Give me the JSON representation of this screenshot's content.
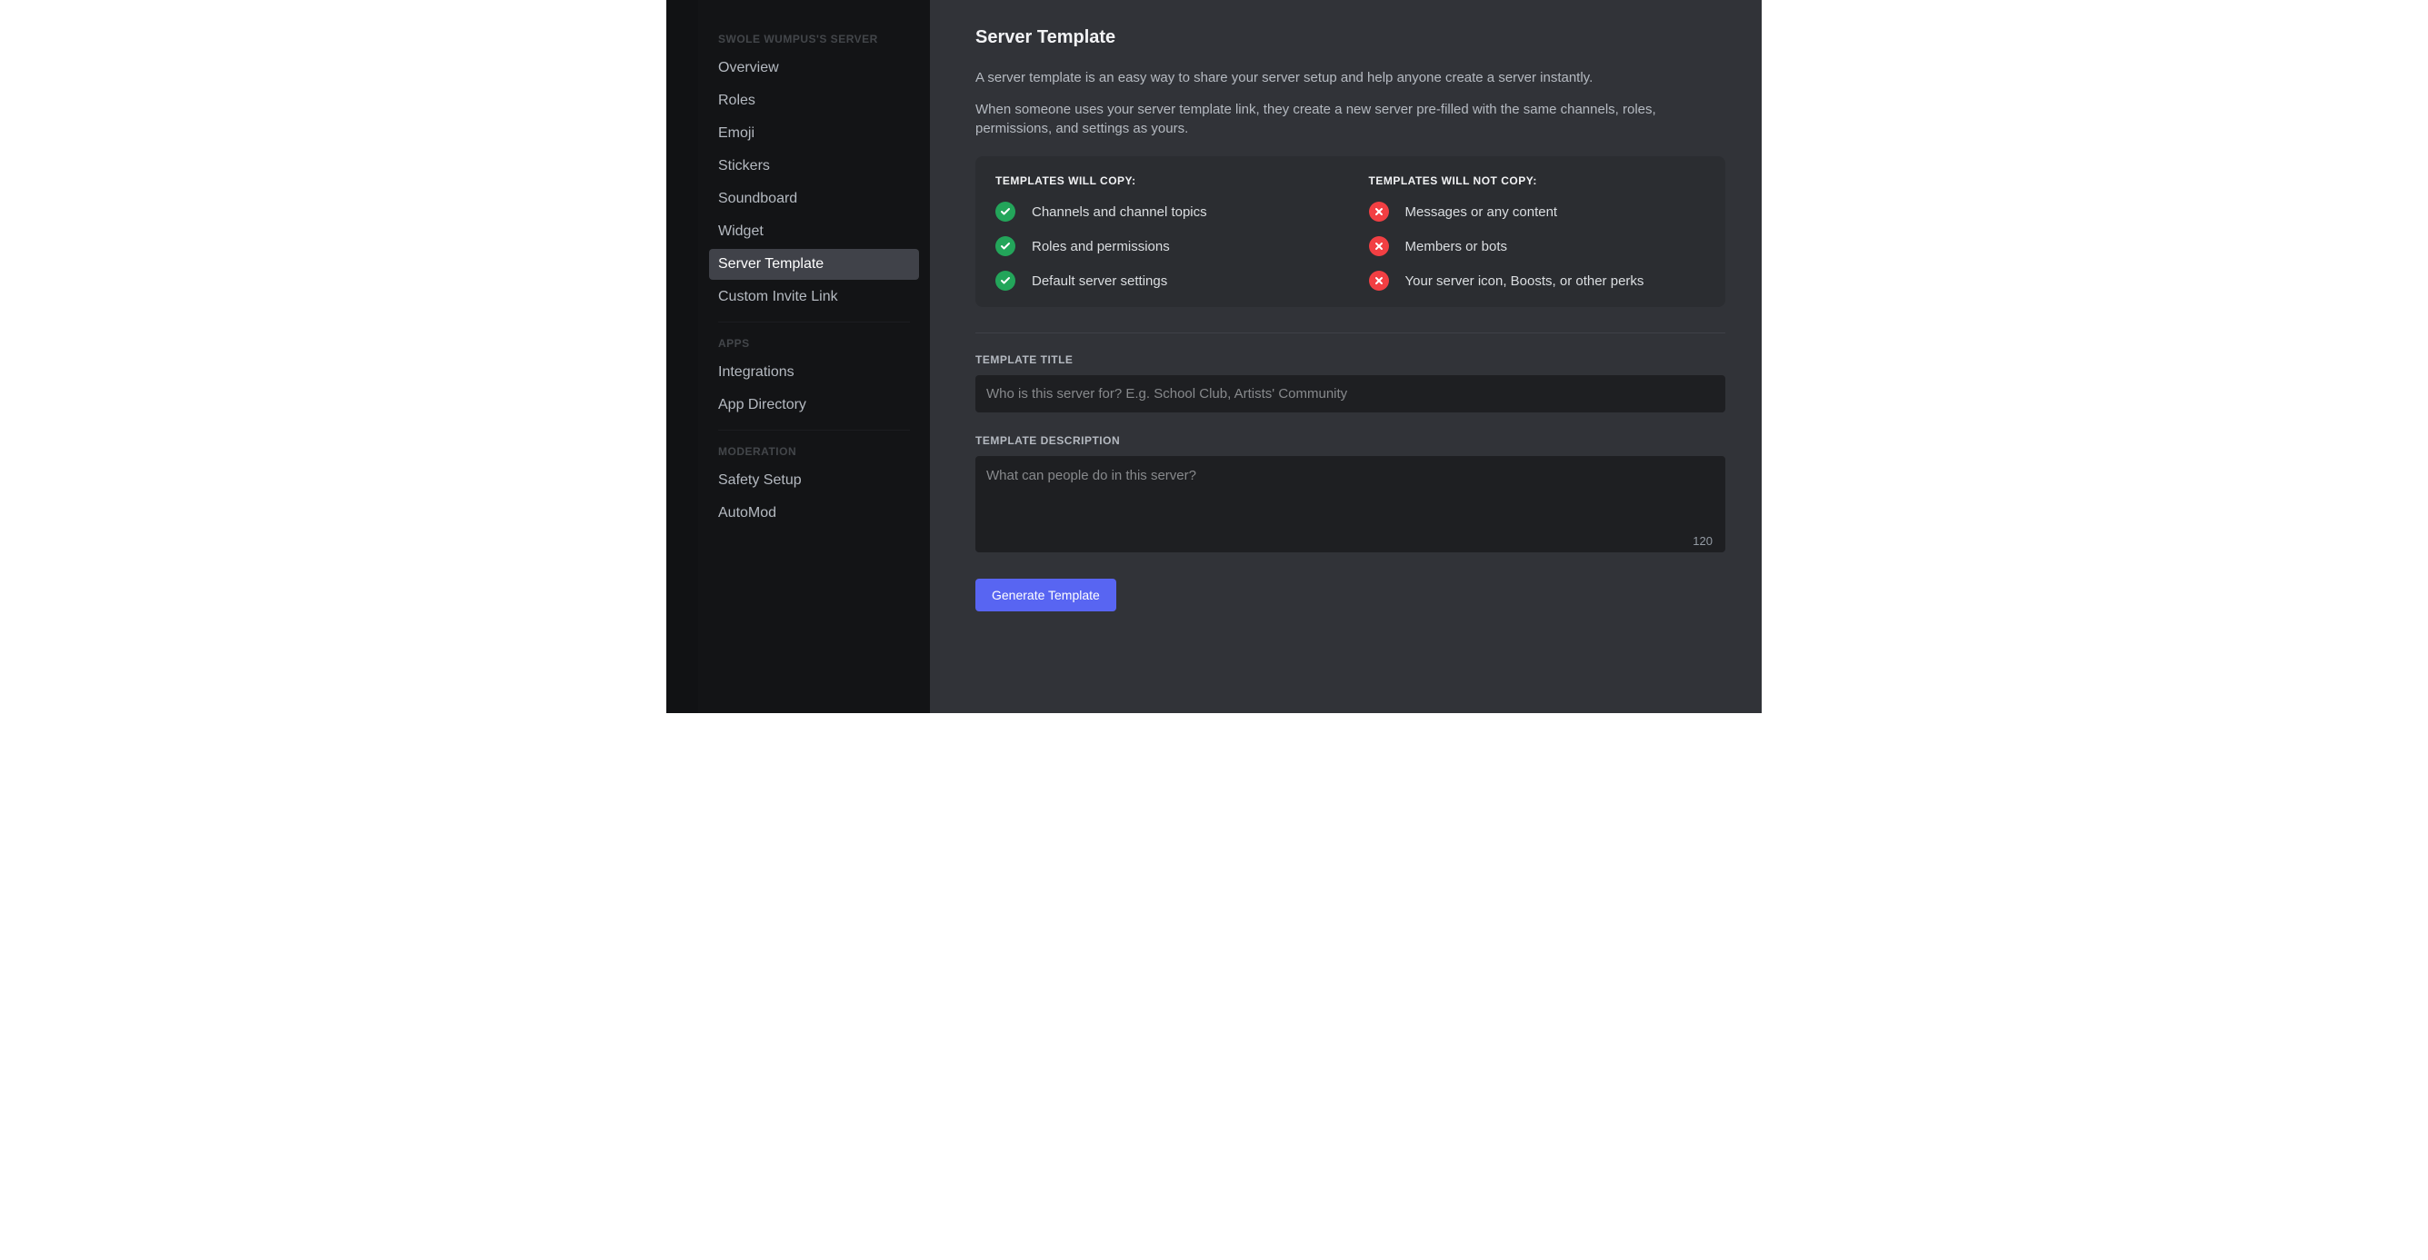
{
  "sidebar": {
    "server_header": "SWOLE WUMPUS'S SERVER",
    "apps_header": "APPS",
    "moderation_header": "MODERATION",
    "items": {
      "overview": "Overview",
      "roles": "Roles",
      "emoji": "Emoji",
      "stickers": "Stickers",
      "soundboard": "Soundboard",
      "widget": "Widget",
      "server_template": "Server Template",
      "custom_invite_link": "Custom Invite Link",
      "integrations": "Integrations",
      "app_directory": "App Directory",
      "safety_setup": "Safety Setup",
      "automod": "AutoMod"
    }
  },
  "main": {
    "title": "Server Template",
    "intro1": "A server template is an easy way to share your server setup and help anyone create a server instantly.",
    "intro2": "When someone uses your server template link, they create a new server pre-filled with the same channels, roles, permissions, and settings as yours.",
    "copy_header": "Templates will copy:",
    "notcopy_header": "Templates will not copy:",
    "copy_items": [
      "Channels and channel topics",
      "Roles and permissions",
      "Default server settings"
    ],
    "notcopy_items": [
      "Messages or any content",
      "Members or bots",
      "Your server icon, Boosts, or other perks"
    ],
    "title_label": "Template Title",
    "title_placeholder": "Who is this server for? E.g. School Club, Artists' Community",
    "desc_label": "Template Description",
    "desc_placeholder": "What can people do in this server?",
    "desc_charcount": "120",
    "generate_label": "Generate Template"
  }
}
